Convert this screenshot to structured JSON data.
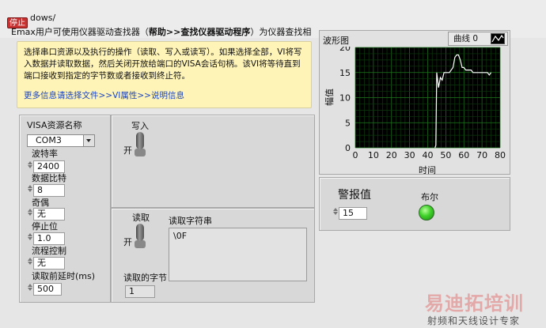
{
  "header": {
    "stop_label": "停止",
    "line1": "dows/",
    "line2_pre": "Emax用户可使用仪器驱动查找器（",
    "line2_bold": "帮助>>查找仪器驱动程序",
    "line2_post": "）为仪器查找相"
  },
  "note": {
    "text": "选择串口资源以及执行的操作（读取、写入或读写）。如果选择全部，VI将写入数据并读取数据，然后关闭开放给端口的VISA会话句柄。该VI将等待直到端口接收到指定的字节数或者接收到终止符。",
    "links": "更多信息请选择文件>>VI属性>>说明信息"
  },
  "serial": {
    "visa_label": "VISA资源名称",
    "visa_value": "COM3",
    "baud_label": "波特率",
    "baud_value": "2400",
    "databits_label": "数据比特",
    "databits_value": "8",
    "parity_label": "奇偶",
    "parity_value": "无",
    "stopbits_label": "停止位",
    "stopbits_value": "1.0",
    "flow_label": "流程控制",
    "flow_value": "无",
    "delay_label": "读取前延时(ms)",
    "delay_value": "500"
  },
  "write": {
    "label": "写入",
    "state": "开"
  },
  "read": {
    "label": "读取",
    "state": "开",
    "string_label": "读取字符串",
    "string_value": "\\0F",
    "bytes_label": "读取的字节",
    "bytes_value": "1"
  },
  "graph": {
    "title": "波形图",
    "legend_label": "曲线 0"
  },
  "alarm": {
    "label": "警报值",
    "value": "15",
    "bool_label": "布尔",
    "bool_on": true
  },
  "watermark": {
    "line1": "易迪拓培训",
    "line2": "射频和天线设计专家"
  },
  "chart_data": {
    "type": "line",
    "title": "",
    "xlabel": "时间",
    "ylabel": "幅值",
    "xlim": [
      0,
      80
    ],
    "ylim": [
      0,
      20
    ],
    "x_ticks": [
      0,
      10,
      20,
      30,
      40,
      50,
      60,
      70,
      80
    ],
    "y_ticks": [
      0,
      5,
      10,
      15,
      20
    ],
    "grid": true,
    "series": [
      {
        "name": "曲线 0",
        "color": "#ffffff",
        "points": [
          [
            44,
            0
          ],
          [
            44.5,
            0.5
          ],
          [
            45,
            15
          ],
          [
            46,
            12
          ],
          [
            47,
            14
          ],
          [
            48,
            13.5
          ],
          [
            49,
            15
          ],
          [
            52,
            15
          ],
          [
            54,
            16
          ],
          [
            55,
            18
          ],
          [
            56,
            18.5
          ],
          [
            57,
            18.5
          ],
          [
            58,
            17.5
          ],
          [
            59,
            16
          ],
          [
            60,
            16
          ],
          [
            61,
            15.5
          ],
          [
            62,
            15.5
          ],
          [
            64,
            15.5
          ],
          [
            65,
            15
          ],
          [
            68,
            15
          ],
          [
            70,
            15
          ],
          [
            73,
            15
          ],
          [
            74,
            14.5
          ],
          [
            75,
            15
          ]
        ]
      }
    ]
  }
}
